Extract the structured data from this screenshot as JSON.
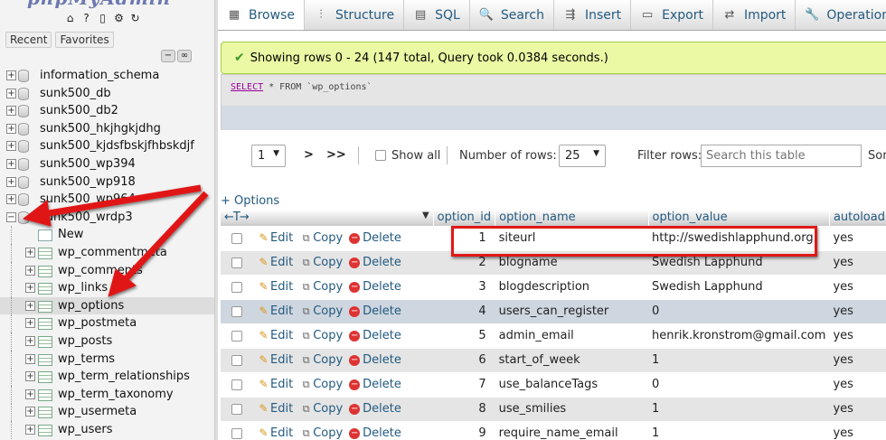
{
  "nav_tabs": {
    "recent": "Recent",
    "favorites": "Favorites"
  },
  "icons": {
    "quick": [
      "home-icon",
      "help-icon",
      "docs-icon",
      "settings-icon",
      "reload-icon"
    ],
    "collapse": [
      "collapse-all-icon",
      "link-icon"
    ]
  },
  "tree": {
    "databases": [
      {
        "name": "information_schema",
        "expander": "+"
      },
      {
        "name": "sunk500_db",
        "expander": "+"
      },
      {
        "name": "sunk500_db2",
        "expander": "+"
      },
      {
        "name": "sunk500_hkjhgkjdhg",
        "expander": "+"
      },
      {
        "name": "sunk500_kjdsfbskjfhbskdjf",
        "expander": "+"
      },
      {
        "name": "sunk500_wp394",
        "expander": "+"
      },
      {
        "name": "sunk500_wp918",
        "expander": "+"
      },
      {
        "name": "sunk500_wp964",
        "expander": "+"
      },
      {
        "name": "sunk500_wrdp3",
        "expander": "−"
      }
    ],
    "tables": [
      {
        "name": "New"
      },
      {
        "name": "wp_commentmeta"
      },
      {
        "name": "wp_comments"
      },
      {
        "name": "wp_links"
      },
      {
        "name": "wp_options"
      },
      {
        "name": "wp_postmeta"
      },
      {
        "name": "wp_posts"
      },
      {
        "name": "wp_terms"
      },
      {
        "name": "wp_term_relationships"
      },
      {
        "name": "wp_term_taxonomy"
      },
      {
        "name": "wp_usermeta"
      },
      {
        "name": "wp_users"
      }
    ]
  },
  "menu": [
    {
      "label": "Browse",
      "icon": "browse-icon",
      "glyph": "▦",
      "active": true
    },
    {
      "label": "Structure",
      "icon": "structure-icon",
      "glyph": "⫶"
    },
    {
      "label": "SQL",
      "icon": "sql-icon",
      "glyph": "▤"
    },
    {
      "label": "Search",
      "icon": "search-icon",
      "glyph": "🔍"
    },
    {
      "label": "Insert",
      "icon": "insert-icon",
      "glyph": "⇶"
    },
    {
      "label": "Export",
      "icon": "export-icon",
      "glyph": "▭"
    },
    {
      "label": "Import",
      "icon": "import-icon",
      "glyph": "⇄"
    },
    {
      "label": "Operations",
      "icon": "operations-icon",
      "glyph": "🔧"
    }
  ],
  "status": {
    "message": "Showing rows 0 - 24 (147 total, Query took 0.0384 seconds.)"
  },
  "sql": {
    "keyword": "SELECT",
    "rest": " * FROM `wp_options`"
  },
  "pager": {
    "page": "1",
    "next": ">",
    "last": ">>",
    "show_all": "Show all",
    "rows_label": "Number of rows:",
    "rows_value": "25",
    "filter_label": "Filter rows:",
    "filter_placeholder": "Search this table",
    "sort_label": "Sort"
  },
  "table": {
    "options_link": "+ Options",
    "sort_arrows": "←T→",
    "columns": [
      "option_id",
      "option_name",
      "option_value",
      "autoload"
    ],
    "actions": {
      "edit": "Edit",
      "copy": "Copy",
      "delete": "Delete"
    },
    "rows": [
      {
        "id": "1",
        "name": "siteurl",
        "value": "http://swedishlapphund.org",
        "autoload": "yes"
      },
      {
        "id": "2",
        "name": "blogname",
        "value": "Swedish Lapphund",
        "autoload": "yes"
      },
      {
        "id": "3",
        "name": "blogdescription",
        "value": "Swedish Lapphund",
        "autoload": "yes"
      },
      {
        "id": "4",
        "name": "users_can_register",
        "value": "0",
        "autoload": "yes"
      },
      {
        "id": "5",
        "name": "admin_email",
        "value": "henrik.kronstrom@gmail.com",
        "autoload": "yes"
      },
      {
        "id": "6",
        "name": "start_of_week",
        "value": "1",
        "autoload": "yes"
      },
      {
        "id": "7",
        "name": "use_balanceTags",
        "value": "0",
        "autoload": "yes"
      },
      {
        "id": "8",
        "name": "use_smilies",
        "value": "1",
        "autoload": "yes"
      },
      {
        "id": "9",
        "name": "require_name_email",
        "value": "1",
        "autoload": "yes"
      }
    ]
  },
  "colors": {
    "annotation": "#e01818",
    "link": "#235a81",
    "success_bg": "#ebf8a4"
  }
}
